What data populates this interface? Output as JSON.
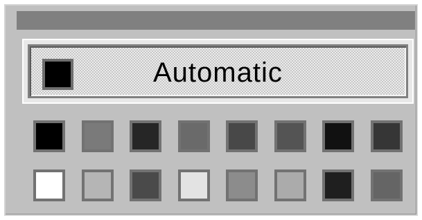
{
  "automatic": {
    "label": "Automatic",
    "swatch_color": "#000000"
  },
  "palette": {
    "rows": [
      [
        {
          "id": "black",
          "color": "#000000"
        },
        {
          "id": "gray-1",
          "color": "#7a7a7a"
        },
        {
          "id": "dark-gray-1",
          "color": "#262626"
        },
        {
          "id": "gray-2",
          "color": "#6a6a6a"
        },
        {
          "id": "dark-gray-2",
          "color": "#484848"
        },
        {
          "id": "dark-gray-3",
          "color": "#545454"
        },
        {
          "id": "near-black",
          "color": "#111111"
        },
        {
          "id": "dark-gray-4",
          "color": "#363636"
        }
      ],
      [
        {
          "id": "white",
          "color": "#ffffff"
        },
        {
          "id": "light-gray-1",
          "color": "#b5b5b5"
        },
        {
          "id": "dark-gray-5",
          "color": "#4a4a4a"
        },
        {
          "id": "light-gray-2",
          "color": "#e3e3e3"
        },
        {
          "id": "gray-3",
          "color": "#8c8c8c"
        },
        {
          "id": "light-gray-3",
          "color": "#ababab"
        },
        {
          "id": "near-black-2",
          "color": "#1f1f1f"
        },
        {
          "id": "gray-4",
          "color": "#656565"
        }
      ]
    ]
  }
}
